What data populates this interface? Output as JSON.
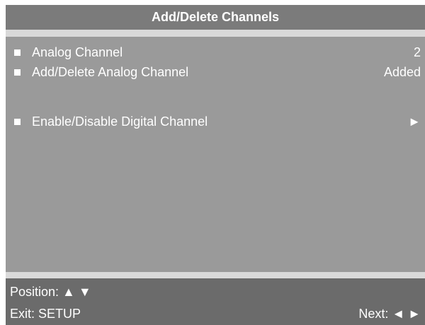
{
  "header": {
    "title": "Add/Delete Channels"
  },
  "menu": {
    "items": [
      {
        "label": "Analog Channel",
        "value": "2"
      },
      {
        "label": "Add/Delete Analog Channel",
        "value": "Added"
      },
      {
        "label": "Enable/Disable Digital Channel",
        "value": "►"
      }
    ]
  },
  "footer": {
    "position_hint": "Position: ▲ ▼",
    "exit_hint": "Exit: SETUP",
    "next_hint": "Next: ◄ ►"
  },
  "colors": {
    "title_bar": "#7b7b7b",
    "menu_panel": "#9a9a9a",
    "footer": "#6b6b6b",
    "separator": "#d9d9d9",
    "text": "#ffffff"
  }
}
